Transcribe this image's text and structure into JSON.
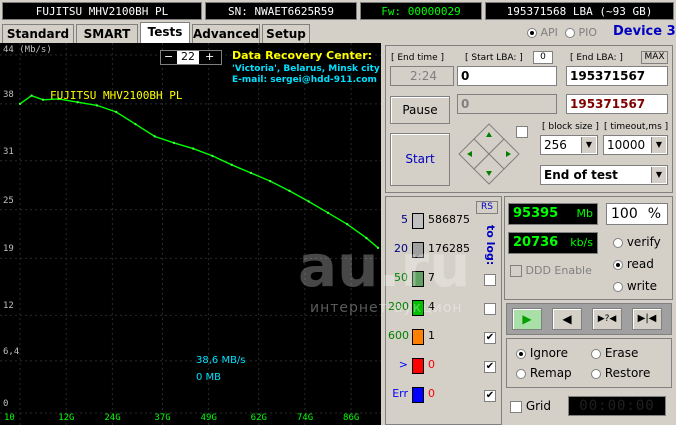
{
  "topbar": {
    "model": "FUJITSU MHV2100BH PL",
    "serial": "SN: NWAET6625R59",
    "firmware": "Fw: 00000029",
    "lba": "195371568 LBA (~93 GB)"
  },
  "tabs": [
    "Standard",
    "SMART",
    "Tests",
    "Advanced",
    "Setup"
  ],
  "active_tab": "Tests",
  "interface": {
    "api_label": "API",
    "pio_label": "PIO",
    "selected": "API",
    "device": "Device 3"
  },
  "chart_header": {
    "unit_label": "44 (Mb/s)",
    "zoom_minus": "−",
    "zoom_value": "22",
    "zoom_plus": "+",
    "model_label": "FUJITSU MHV2100BH PL",
    "drc_title": "Data Recovery Center:",
    "drc_line1": "'Victoria', Belarus, Minsk city",
    "drc_line2": "E-mail: sergei@hdd-911.com",
    "speed_label": "38,6 MB/s",
    "mb_label": "0 MB"
  },
  "chart_data": {
    "type": "line",
    "y_ticks": [
      "44 (Mb/s)",
      "38",
      "31",
      "25",
      "19",
      "12",
      "6,4",
      "0"
    ],
    "x_ticks": [
      "10",
      "12G",
      "24G",
      "37G",
      "49G",
      "62G",
      "74G",
      "86G"
    ],
    "ylim": [
      0,
      44
    ],
    "xlim": [
      0,
      93
    ],
    "series": [
      {
        "values_x": [
          0,
          3,
          6,
          10,
          15,
          20,
          25,
          30,
          35,
          40,
          45,
          50,
          55,
          60,
          65,
          70,
          75,
          80,
          85,
          90,
          93
        ],
        "values_y": [
          38,
          39,
          38.5,
          38.6,
          38.2,
          37.8,
          37,
          35.5,
          34,
          33.2,
          32.5,
          31.6,
          30.5,
          29.5,
          28.5,
          27.3,
          26,
          24.6,
          23.2,
          21.5,
          20.3
        ]
      }
    ],
    "grid": true
  },
  "end_time": {
    "label": "[ End time ]",
    "value": "2:24"
  },
  "start_lba": {
    "label": "[ Start LBA: ]",
    "value": "0",
    "aux": "0",
    "current": "0"
  },
  "end_lba": {
    "label": "[ End LBA: ]",
    "max_label": "MAX",
    "value": "195371567",
    "current": "195371567"
  },
  "buttons": {
    "pause": "Pause",
    "start": "Start"
  },
  "block_size": {
    "label": "[ block size ]",
    "value": "256"
  },
  "timeout": {
    "label": "[ timeout,ms ]",
    "value": "10000"
  },
  "end_action": {
    "value": "End of test"
  },
  "blocks": {
    "rs_label": "RS",
    "to_log_label": "to log:",
    "rows": [
      {
        "ms": "5",
        "count": "586875",
        "color": "#c0c0c0",
        "log": false
      },
      {
        "ms": "20",
        "count": "176285",
        "color": "#a0a0a0",
        "log": false
      },
      {
        "ms": "50",
        "count": "7",
        "color": "#60a060",
        "log": false
      },
      {
        "ms": "200",
        "count": "4",
        "color": "#00c000",
        "log": false
      },
      {
        "ms": "600",
        "count": "1",
        "color": "#ff8000",
        "log": true
      },
      {
        "ms": ">",
        "count": "0",
        "color": "#ff0000",
        "log": true
      },
      {
        "ms": "Err",
        "count": "0",
        "color": "#0000ff",
        "log": true
      }
    ]
  },
  "stats": {
    "mb_value": "95395",
    "mb_unit": "Mb",
    "percent_value": "100",
    "percent_unit": "%",
    "speed_value": "20736",
    "speed_unit": "kb/s",
    "ddd_label": "DDD Enable"
  },
  "modes": {
    "verify": "verify",
    "read": "read",
    "write": "write",
    "selected": "read"
  },
  "actions": {
    "ignore": "Ignore",
    "erase": "Erase",
    "remap": "Remap",
    "restore": "Restore",
    "selected": "Ignore"
  },
  "grid_label": "Grid",
  "timer": "00:00:00",
  "controls": {
    "play": "▶",
    "back": "◀",
    "skip": "▶?◀",
    "end": "▶|◀"
  },
  "watermark": {
    "brand": "au.ru",
    "sub": "интернет-аукцион"
  }
}
